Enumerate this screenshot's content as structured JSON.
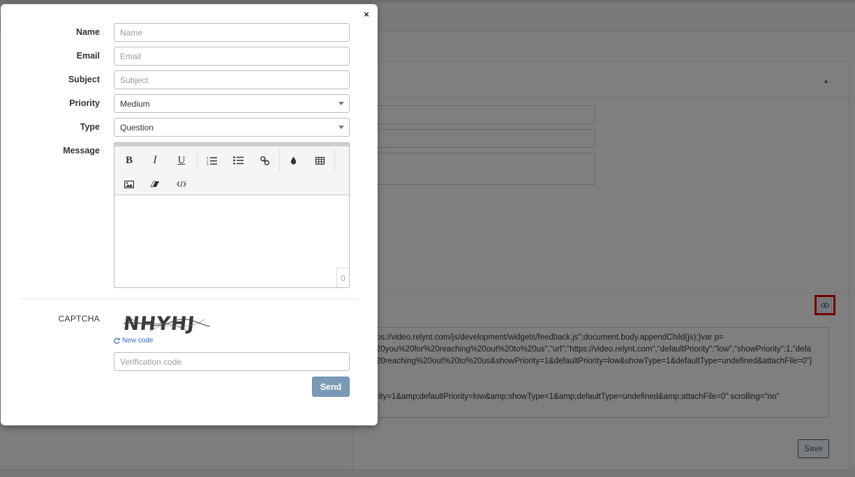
{
  "modal": {
    "close_label": "×",
    "fields": {
      "name": {
        "label": "Name",
        "placeholder": "Name"
      },
      "email": {
        "label": "Email",
        "placeholder": "Email"
      },
      "subject": {
        "label": "Subject",
        "placeholder": "Subject"
      },
      "priority": {
        "label": "Priority",
        "value": "Medium"
      },
      "type": {
        "label": "Type",
        "value": "Question"
      },
      "message": {
        "label": "Message",
        "char_count": "0"
      }
    },
    "editor_toolbar": [
      "bold-icon",
      "italic-icon",
      "underline-icon",
      "ordered-list-icon",
      "unordered-list-icon",
      "link-icon",
      "color-drop-icon",
      "table-icon",
      "image-icon",
      "eraser-icon",
      "code-icon"
    ],
    "captcha": {
      "label": "CAPTCHA",
      "image_text": "NHYHJ",
      "new_code_label": "New code",
      "input_placeholder": "Verification code"
    },
    "send_label": "Send"
  },
  "background": {
    "code_lines": [
      "ps://video.relynt.com/js/development/widgets/feedback.js\";document.body.appendChild(js);}var p=",
      "20you%20for%20reaching%20out%20to%20us\",\"url\":\"https://video.relynt.com\",\"defaultPriority\":\"low\",\"showPriority\":1,\"defa",
      "20reaching%20out%20to%20us&showPriority=1&defaultPriority=low&showType=1&defaultType=undefined&attachFile=0\"}",
      "rity=1&amp;defaultPriority=low&amp;showType=1&amp;defaultType=undefined&amp;attachFile=0\" scrolling=\"no\""
    ],
    "save_label": "Save"
  },
  "colors": {
    "overlay": "#000000",
    "send_button": "#7a9ab7",
    "highlight_border": "#e00000",
    "link": "#2a6ebb"
  }
}
